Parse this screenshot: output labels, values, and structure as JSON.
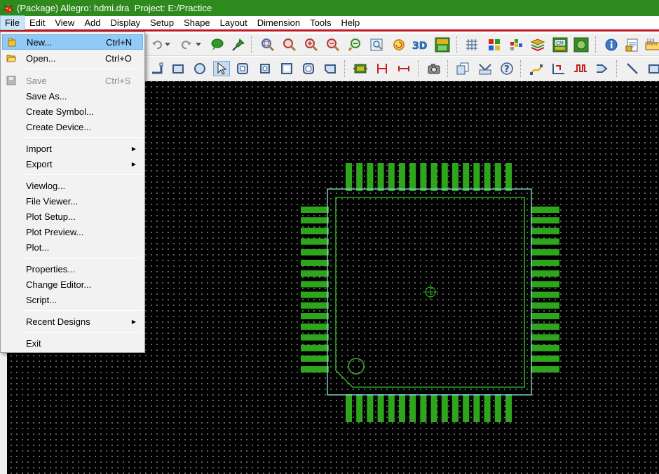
{
  "window": {
    "title": "(Package) Allegro: hdmi.dra  Project: E:/Practice",
    "icon": "allegro-bug-icon",
    "colors": {
      "titlebar": "#2f8a1e",
      "menubar_underline": "#c8141e",
      "pad_fill": "#2fa51e",
      "outline": "#7fd6d0"
    }
  },
  "menubar": {
    "items": [
      {
        "label": "File"
      },
      {
        "label": "Edit"
      },
      {
        "label": "View"
      },
      {
        "label": "Add"
      },
      {
        "label": "Display"
      },
      {
        "label": "Setup"
      },
      {
        "label": "Shape"
      },
      {
        "label": "Layout"
      },
      {
        "label": "Dimension"
      },
      {
        "label": "Tools"
      },
      {
        "label": "Help"
      }
    ]
  },
  "file_menu": {
    "new": {
      "label": "New...",
      "shortcut": "Ctrl+N"
    },
    "open": {
      "label": "Open...",
      "shortcut": "Ctrl+O"
    },
    "save": {
      "label": "Save",
      "shortcut": "Ctrl+S"
    },
    "save_as": {
      "label": "Save As..."
    },
    "create_symbol": {
      "label": "Create Symbol..."
    },
    "create_device": {
      "label": "Create Device..."
    },
    "import": {
      "label": "Import"
    },
    "export": {
      "label": "Export"
    },
    "viewlog": {
      "label": "Viewlog..."
    },
    "file_viewer": {
      "label": "File Viewer..."
    },
    "plot_setup": {
      "label": "Plot Setup..."
    },
    "plot_preview": {
      "label": "Plot Preview..."
    },
    "plot": {
      "label": "Plot..."
    },
    "properties": {
      "label": "Properties..."
    },
    "change_editor": {
      "label": "Change Editor..."
    },
    "script": {
      "label": "Script..."
    },
    "recent_designs": {
      "label": "Recent Designs"
    },
    "exit": {
      "label": "Exit"
    }
  },
  "canvas": {
    "component": "qfp-64-footprint",
    "pins_per_side": 16
  }
}
